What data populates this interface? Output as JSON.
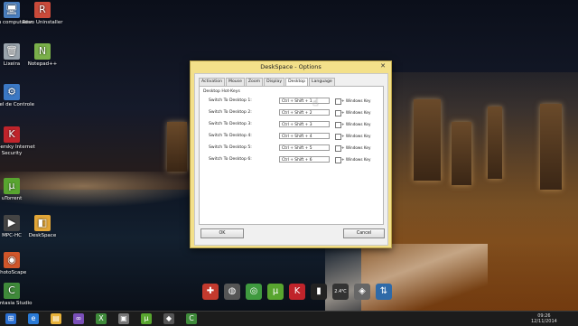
{
  "desktop_icons": [
    {
      "label": "Meu computador",
      "icon": "computer-icon",
      "color": "#4a7fc0"
    },
    {
      "label": "Revo Uninstaller",
      "icon": "revo-icon",
      "color": "#c94a3a"
    },
    {
      "label": "Lixeira",
      "icon": "recycle-bin-icon",
      "color": "#9aa4ad"
    },
    {
      "label": "Notepad++",
      "icon": "notepad-icon",
      "color": "#7ab04a"
    },
    {
      "label": "Painel de Controle",
      "icon": "control-panel-icon",
      "color": "#3b78c4"
    },
    {
      "label": "Kaspersky Internet Security",
      "icon": "kaspersky-icon",
      "color": "#c0242b"
    },
    {
      "label": "uTorrent",
      "icon": "utorrent-icon",
      "color": "#58a52f"
    },
    {
      "label": "MPC-HC",
      "icon": "mpc-icon",
      "color": "#444444"
    },
    {
      "label": "DeskSpace",
      "icon": "deskspace-icon",
      "color": "#e2a638"
    },
    {
      "label": "PhotoScape",
      "icon": "photoscape-icon",
      "color": "#d0562a"
    },
    {
      "label": "Camtasia Studio",
      "icon": "camtasia-icon",
      "color": "#3f8a3a"
    }
  ],
  "dialog": {
    "title": "DeskSpace - Options",
    "close_glyph": "✕",
    "tabs": [
      "Activation",
      "Mouse",
      "Zoom",
      "Display",
      "Desktop",
      "Language"
    ],
    "active_tab": "Desktop",
    "group_title": "Desktop Hot-Keys",
    "checkbox_label": "+ Windows Key",
    "rows": [
      {
        "label": "Switch To Desktop 1:",
        "hotkey": "Ctrl + Shift + 1"
      },
      {
        "label": "Switch To Desktop 2:",
        "hotkey": "Ctrl + Shift + 2"
      },
      {
        "label": "Switch To Desktop 3:",
        "hotkey": "Ctrl + Shift + 3"
      },
      {
        "label": "Switch To Desktop 4:",
        "hotkey": "Ctrl + Shift + 4"
      },
      {
        "label": "Switch To Desktop 5:",
        "hotkey": "Ctrl + Shift + 5"
      },
      {
        "label": "Switch To Desktop 6:",
        "hotkey": "Ctrl + Shift + 6"
      }
    ],
    "ok_label": "OK",
    "cancel_label": "Cancel"
  },
  "dock": {
    "items": [
      {
        "icon": "red-app-icon",
        "color": "#c33a2e"
      },
      {
        "icon": "globe-icon",
        "color": "#555555"
      },
      {
        "icon": "chrome-icon",
        "color": "#3f9a3f"
      },
      {
        "icon": "utorrent-icon",
        "color": "#58a52f"
      },
      {
        "icon": "kaspersky-icon",
        "color": "#c0242b"
      },
      {
        "icon": "video-icon",
        "color": "#222222"
      },
      {
        "icon": "temperature-icon",
        "color": "#333333"
      },
      {
        "icon": "system-icon",
        "color": "#666666"
      },
      {
        "icon": "network-icon",
        "color": "#2f6aa8"
      }
    ],
    "temperature": "2.4℃"
  },
  "taskbar": {
    "items": [
      {
        "icon": "start-windows-icon",
        "color": "#2b6fd0"
      },
      {
        "icon": "ie-icon",
        "color": "#2a7ad6"
      },
      {
        "icon": "explorer-icon",
        "color": "#e8b23a"
      },
      {
        "icon": "visual-studio-icon",
        "color": "#7a4fb8"
      },
      {
        "icon": "xbox-icon",
        "color": "#3f8a3a"
      },
      {
        "icon": "photos-icon",
        "color": "#777777"
      },
      {
        "icon": "utorrent-icon",
        "color": "#58a52f"
      },
      {
        "icon": "app-icon",
        "color": "#555555"
      },
      {
        "icon": "camtasia-icon",
        "color": "#3f8a3a"
      }
    ],
    "time": "09:26",
    "date": "12/11/2014"
  }
}
